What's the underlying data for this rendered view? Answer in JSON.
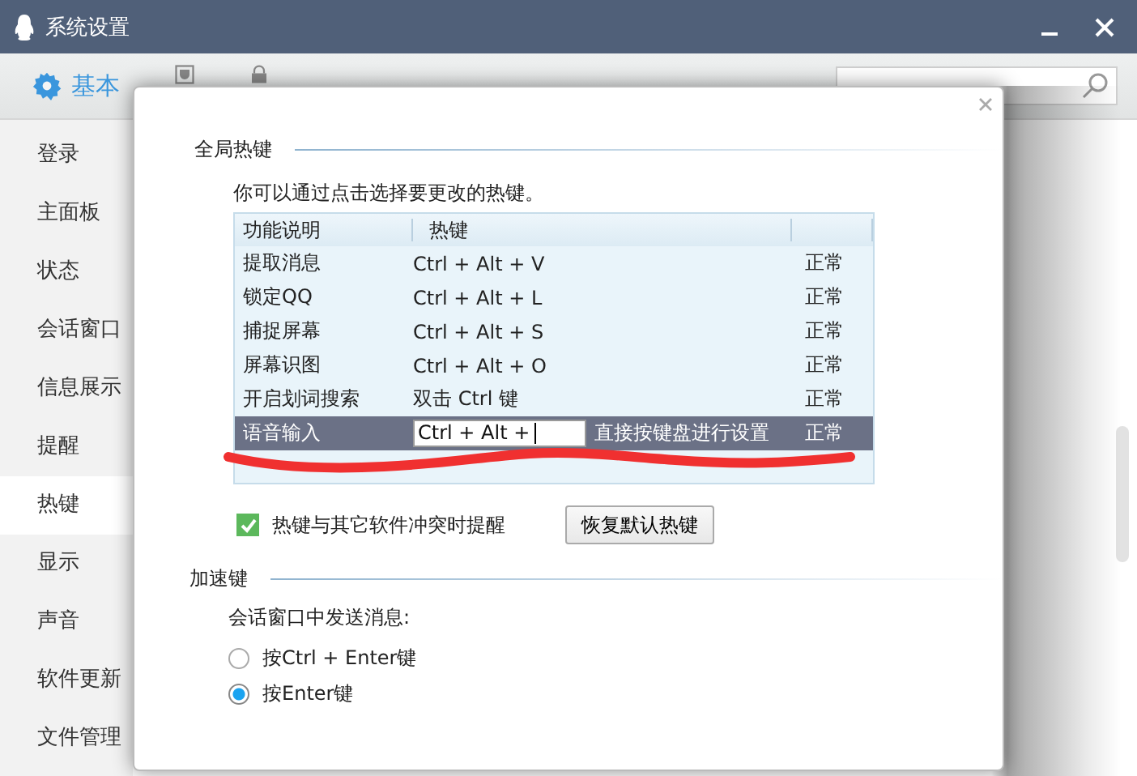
{
  "window": {
    "title": "系统设置"
  },
  "tabs": [
    {
      "label": "基本",
      "selected": true
    },
    {
      "selected": false
    },
    {
      "selected": false
    }
  ],
  "sidebar": {
    "items": [
      {
        "label": "登录",
        "selected": false
      },
      {
        "label": "主面板",
        "selected": false
      },
      {
        "label": "状态",
        "selected": false
      },
      {
        "label": "会话窗口",
        "selected": false
      },
      {
        "label": "信息展示",
        "selected": false
      },
      {
        "label": "提醒",
        "selected": false
      },
      {
        "label": "热键",
        "selected": true
      },
      {
        "label": "显示",
        "selected": false
      },
      {
        "label": "声音",
        "selected": false
      },
      {
        "label": "软件更新",
        "selected": false
      },
      {
        "label": "文件管理",
        "selected": false
      }
    ]
  },
  "dialog": {
    "section_title": "全局热键",
    "description": "你可以通过点击选择要更改的热键。",
    "table": {
      "columns": [
        "功能说明",
        "热键"
      ],
      "rows": [
        {
          "function": "提取消息",
          "hotkey": "Ctrl + Alt + V",
          "status": "正常",
          "selected": false
        },
        {
          "function": "锁定QQ",
          "hotkey": "Ctrl + Alt + L",
          "status": "正常",
          "selected": false
        },
        {
          "function": "捕捉屏幕",
          "hotkey": "Ctrl + Alt + S",
          "status": "正常",
          "selected": false
        },
        {
          "function": "屏幕识图",
          "hotkey": "Ctrl + Alt + O",
          "status": "正常",
          "selected": false
        },
        {
          "function": "开启划词搜索",
          "hotkey": "双击 Ctrl 键",
          "status": "正常",
          "selected": false
        },
        {
          "function": "语音输入",
          "hotkey": "Ctrl + Alt +",
          "hint": "直接按键盘进行设置",
          "status": "正常",
          "selected": true,
          "editing": true
        }
      ]
    },
    "conflict_alert": {
      "label": "热键与其它软件冲突时提醒",
      "checked": true
    },
    "restore_button": "恢复默认热键",
    "accel": {
      "section_title": "加速键",
      "prompt": "会话窗口中发送消息:",
      "options": [
        {
          "label": "按Ctrl + Enter键",
          "selected": false
        },
        {
          "label": "按Enter键",
          "selected": true
        }
      ]
    }
  }
}
